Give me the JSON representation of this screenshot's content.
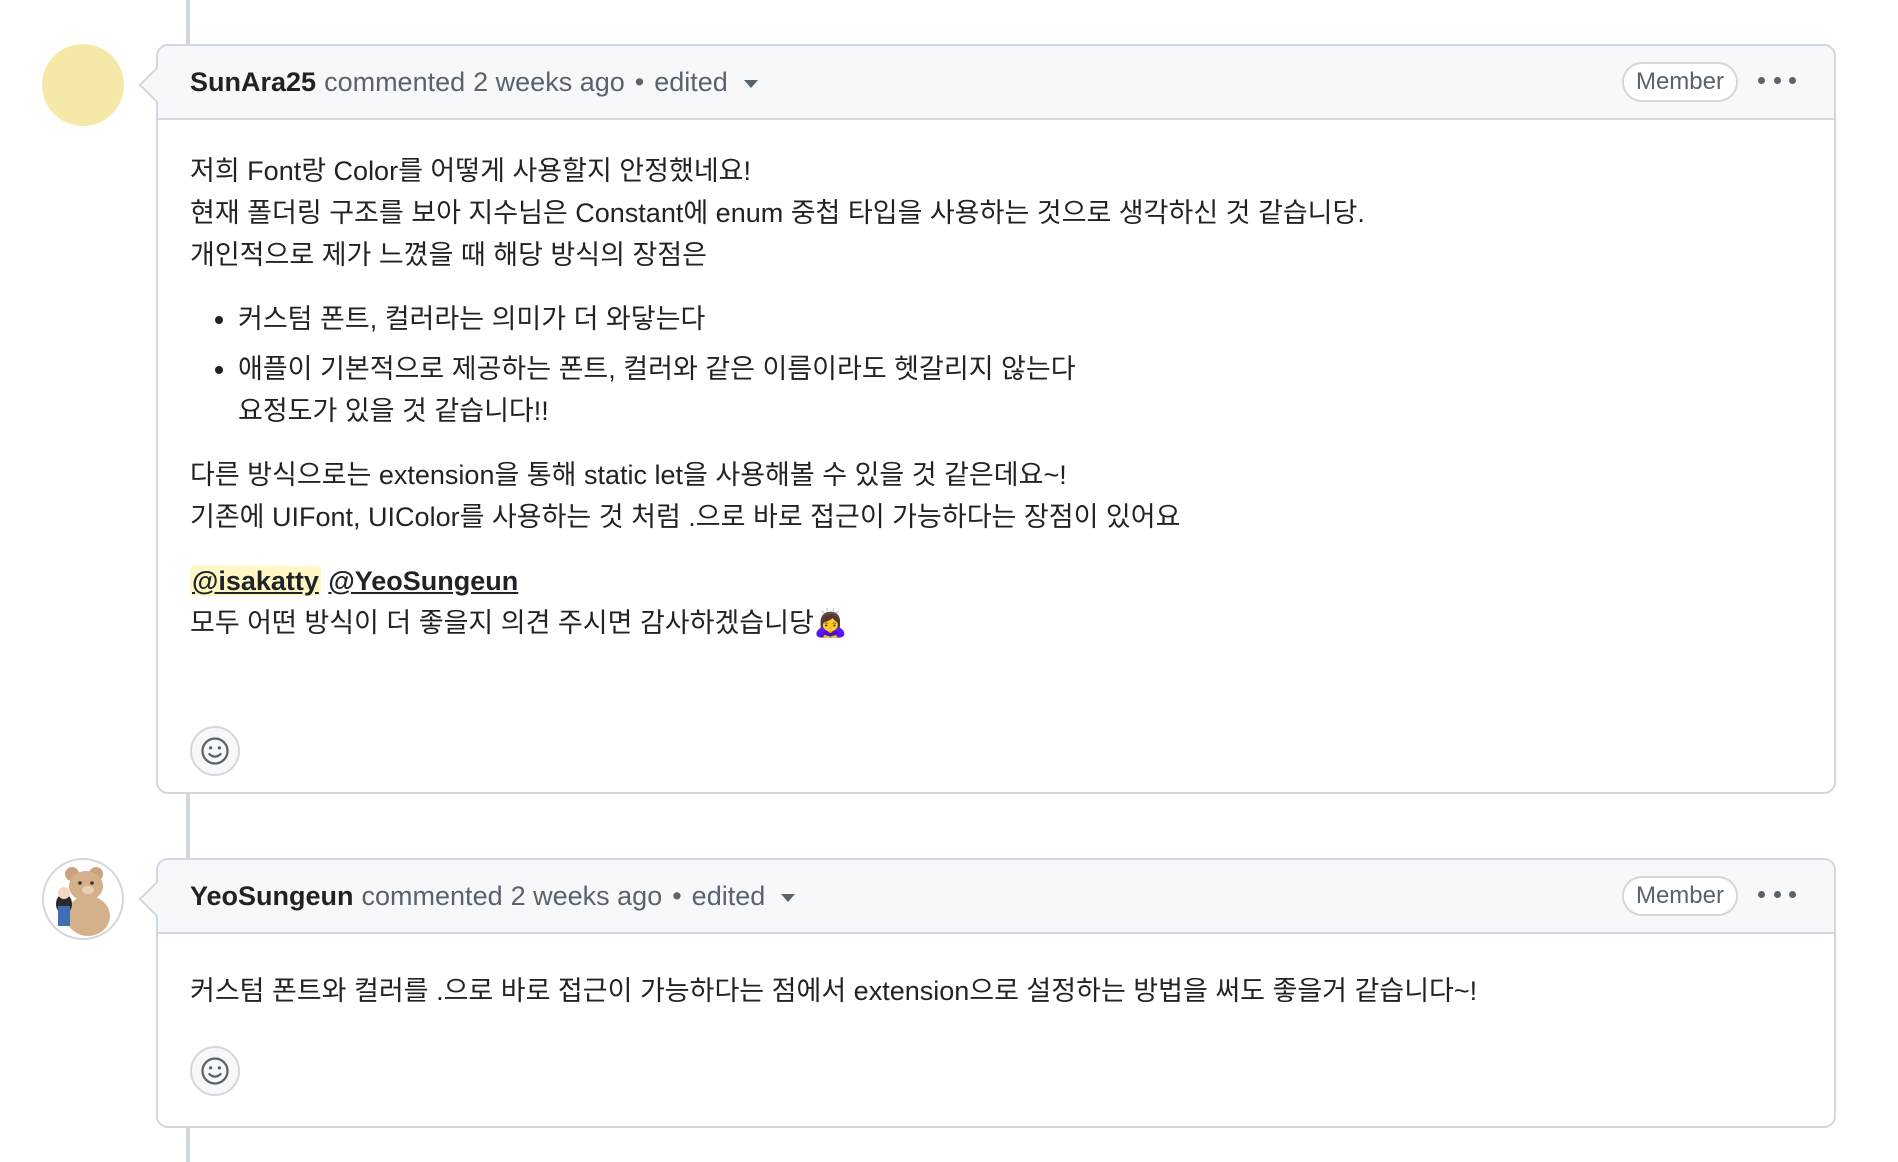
{
  "comments": [
    {
      "author": "SunAra25",
      "commented": "commented",
      "time": "2 weeks ago",
      "dot": "•",
      "edited": "edited",
      "badge": "Member",
      "para1": [
        "저희 Font랑 Color를 어떻게 사용할지 안정했네요!",
        "현재 폴더링 구조를 보아 지수님은 Constant에 enum 중첩 타입을 사용하는 것으로 생각하신 것 같습니당.",
        "개인적으로 제가 느꼈을 때 해당 방식의 장점은"
      ],
      "bullets": [
        "커스텀 폰트, 컬러라는 의미가 더 와닿는다",
        "애플이 기본적으로 제공하는 폰트, 컬러와 같은 이름이라도 헷갈리지 않는다"
      ],
      "bullet_continuation": "요정도가 있을 것 같습니다!!",
      "para2": [
        "다른 방식으로는 extension을 통해 static let을 사용해볼 수 있을 것 같은데요~!",
        "기존에 UIFont, UIColor를 사용하는 것 처럼 .으로 바로 접근이 가능하다는 장점이 있어요"
      ],
      "mentions": [
        "@isakatty",
        "@YeoSungeun"
      ],
      "closing": "모두 어떤 방식이 더 좋을지 의견 주시면 감사하겠습니당🙇‍♀️"
    },
    {
      "author": "YeoSungeun",
      "commented": "commented",
      "time": "2 weeks ago",
      "dot": "•",
      "edited": "edited",
      "badge": "Member",
      "text": "커스텀 폰트와 컬러를 .으로 바로 접근이 가능하다는 점에서 extension으로 설정하는 방법을 써도 좋을거 같습니다~!"
    }
  ],
  "icons": {
    "kebab": "kebab-horizontal-icon",
    "emoji": "smiley-icon",
    "caret": "triangle-down-icon"
  },
  "colors": {
    "border": "#d0d7de",
    "header_bg": "#f6f8fa",
    "text": "#1f2328",
    "muted": "#59636e",
    "mention_highlight": "#fff8c5",
    "avatar1": "#f6e9a8"
  }
}
